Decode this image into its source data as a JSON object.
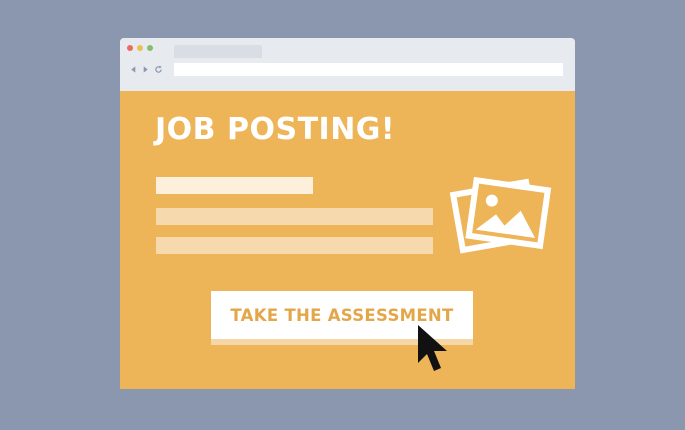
{
  "page": {
    "title": "JOB POSTING!"
  },
  "cta": {
    "label": "TAKE THE ASSESSMENT"
  },
  "icons": {
    "back": "chevron-left-icon",
    "forward": "chevron-right-icon",
    "reload": "reload-icon",
    "image": "photos-icon",
    "cursor": "mouse-pointer-icon"
  },
  "colors": {
    "background": "#8b97ae",
    "page": "#edb458",
    "accent_text": "#e3a649",
    "chrome": "#e7ebf0",
    "window_dots": [
      "#ec6b5f",
      "#f1bd4f",
      "#7fc26b"
    ]
  }
}
